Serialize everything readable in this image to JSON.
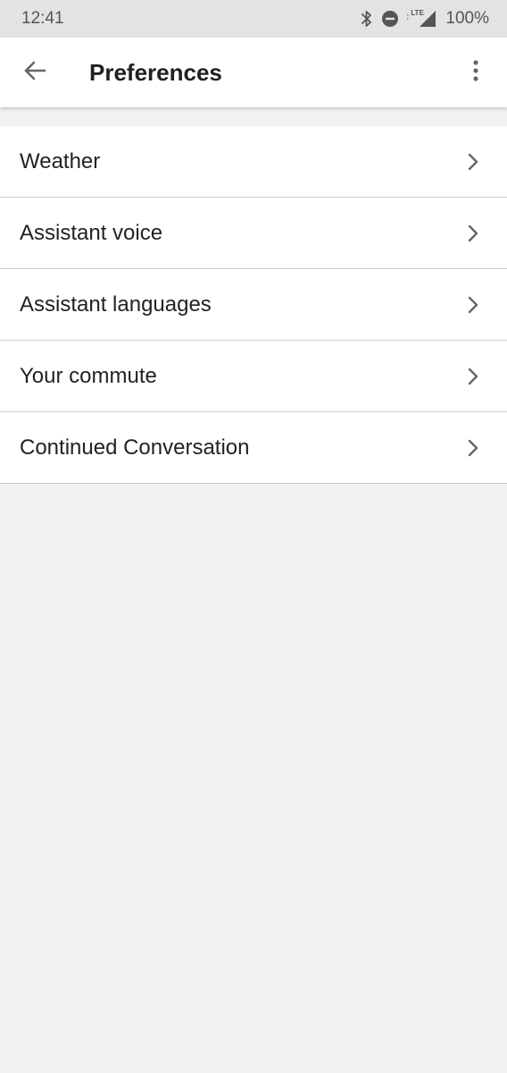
{
  "status_bar": {
    "time": "12:41",
    "network_label": "LTE",
    "battery": "100%",
    "icons": [
      "bluetooth-icon",
      "do-not-disturb-icon",
      "signal-icon"
    ]
  },
  "app_bar": {
    "title": "Preferences",
    "back_icon": "arrow-back-icon",
    "menu_icon": "more-vert-icon"
  },
  "preferences": {
    "items": [
      {
        "label": "Weather"
      },
      {
        "label": "Assistant voice"
      },
      {
        "label": "Assistant languages"
      },
      {
        "label": "Your commute"
      },
      {
        "label": "Continued Conversation"
      }
    ],
    "chevron_icon": "chevron-right-icon"
  },
  "colors": {
    "background": "#f2f2f2",
    "status_bar": "#e3e3e3",
    "surface": "#ffffff",
    "divider": "#cfcfcf",
    "text_primary": "#222222",
    "icon": "#666666"
  }
}
